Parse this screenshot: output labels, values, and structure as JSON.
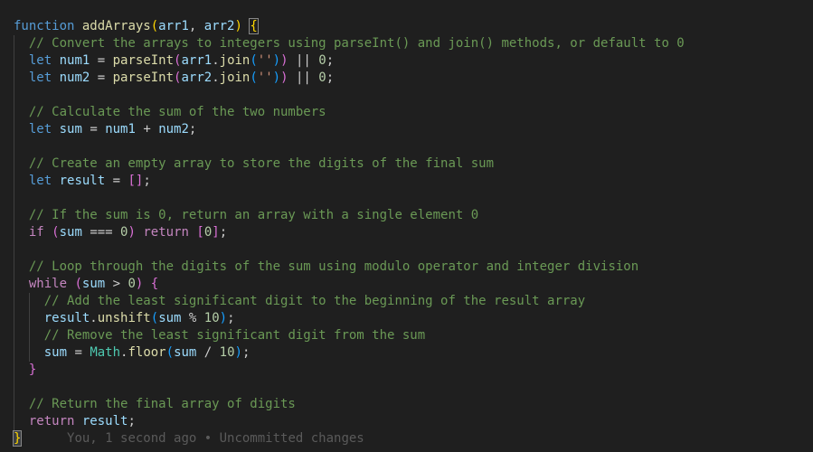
{
  "editor": {
    "lines": [
      {
        "id": "l1",
        "indent": "",
        "tokens": [
          [
            "kw",
            "function"
          ],
          [
            "pn",
            " "
          ],
          [
            "fn",
            "addArrays"
          ],
          [
            "br1",
            "("
          ],
          [
            "var",
            "arr1"
          ],
          [
            "pn",
            ", "
          ],
          [
            "var",
            "arr2"
          ],
          [
            "br1",
            ")"
          ],
          [
            "pn",
            " "
          ],
          [
            "br1",
            "{"
          ]
        ]
      },
      {
        "id": "l2",
        "indent": "  ",
        "tokens": [
          [
            "cm",
            "// Convert the arrays to integers using parseInt() and join() methods, or default to 0"
          ]
        ]
      },
      {
        "id": "l3",
        "indent": "  ",
        "tokens": [
          [
            "kw",
            "let"
          ],
          [
            "pn",
            " "
          ],
          [
            "var",
            "num1"
          ],
          [
            "pn",
            " = "
          ],
          [
            "fn",
            "parseInt"
          ],
          [
            "br2",
            "("
          ],
          [
            "var",
            "arr1"
          ],
          [
            "pn",
            "."
          ],
          [
            "fn",
            "join"
          ],
          [
            "br3",
            "("
          ],
          [
            "str",
            "''"
          ],
          [
            "br3",
            ")"
          ],
          [
            "br2",
            ")"
          ],
          [
            "pn",
            " || "
          ],
          [
            "num",
            "0"
          ],
          [
            "pn",
            ";"
          ]
        ]
      },
      {
        "id": "l4",
        "indent": "  ",
        "tokens": [
          [
            "kw",
            "let"
          ],
          [
            "pn",
            " "
          ],
          [
            "var",
            "num2"
          ],
          [
            "pn",
            " = "
          ],
          [
            "fn",
            "parseInt"
          ],
          [
            "br2",
            "("
          ],
          [
            "var",
            "arr2"
          ],
          [
            "pn",
            "."
          ],
          [
            "fn",
            "join"
          ],
          [
            "br3",
            "("
          ],
          [
            "str",
            "''"
          ],
          [
            "br3",
            ")"
          ],
          [
            "br2",
            ")"
          ],
          [
            "pn",
            " || "
          ],
          [
            "num",
            "0"
          ],
          [
            "pn",
            ";"
          ]
        ]
      },
      {
        "id": "l5",
        "indent": "",
        "tokens": []
      },
      {
        "id": "l6",
        "indent": "  ",
        "tokens": [
          [
            "cm",
            "// Calculate the sum of the two numbers"
          ]
        ]
      },
      {
        "id": "l7",
        "indent": "  ",
        "tokens": [
          [
            "kw",
            "let"
          ],
          [
            "pn",
            " "
          ],
          [
            "var",
            "sum"
          ],
          [
            "pn",
            " = "
          ],
          [
            "var",
            "num1"
          ],
          [
            "pn",
            " + "
          ],
          [
            "var",
            "num2"
          ],
          [
            "pn",
            ";"
          ]
        ]
      },
      {
        "id": "l8",
        "indent": "",
        "tokens": []
      },
      {
        "id": "l9",
        "indent": "  ",
        "tokens": [
          [
            "cm",
            "// Create an empty array to store the digits of the final sum"
          ]
        ]
      },
      {
        "id": "l10",
        "indent": "  ",
        "tokens": [
          [
            "kw",
            "let"
          ],
          [
            "pn",
            " "
          ],
          [
            "var",
            "result"
          ],
          [
            "pn",
            " = "
          ],
          [
            "br2",
            "[]"
          ],
          [
            "pn",
            ";"
          ]
        ]
      },
      {
        "id": "l11",
        "indent": "",
        "tokens": []
      },
      {
        "id": "l12",
        "indent": "  ",
        "tokens": [
          [
            "cm",
            "// If the sum is 0, return an array with a single element 0"
          ]
        ]
      },
      {
        "id": "l13",
        "indent": "  ",
        "tokens": [
          [
            "kw2",
            "if"
          ],
          [
            "pn",
            " "
          ],
          [
            "br2",
            "("
          ],
          [
            "var",
            "sum"
          ],
          [
            "pn",
            " === "
          ],
          [
            "num",
            "0"
          ],
          [
            "br2",
            ")"
          ],
          [
            "pn",
            " "
          ],
          [
            "kw2",
            "return"
          ],
          [
            "pn",
            " "
          ],
          [
            "br2",
            "["
          ],
          [
            "num",
            "0"
          ],
          [
            "br2",
            "]"
          ],
          [
            "pn",
            ";"
          ]
        ]
      },
      {
        "id": "l14",
        "indent": "",
        "tokens": []
      },
      {
        "id": "l15",
        "indent": "  ",
        "tokens": [
          [
            "cm",
            "// Loop through the digits of the sum using modulo operator and integer division"
          ]
        ]
      },
      {
        "id": "l16",
        "indent": "  ",
        "tokens": [
          [
            "kw2",
            "while"
          ],
          [
            "pn",
            " "
          ],
          [
            "br2",
            "("
          ],
          [
            "var",
            "sum"
          ],
          [
            "pn",
            " > "
          ],
          [
            "num",
            "0"
          ],
          [
            "br2",
            ")"
          ],
          [
            "pn",
            " "
          ],
          [
            "br2",
            "{"
          ]
        ]
      },
      {
        "id": "l17",
        "indent": "    ",
        "tokens": [
          [
            "cm",
            "// Add the least significant digit to the beginning of the result array"
          ]
        ]
      },
      {
        "id": "l18",
        "indent": "    ",
        "tokens": [
          [
            "var",
            "result"
          ],
          [
            "pn",
            "."
          ],
          [
            "fn",
            "unshift"
          ],
          [
            "br3",
            "("
          ],
          [
            "var",
            "sum"
          ],
          [
            "pn",
            " % "
          ],
          [
            "num",
            "10"
          ],
          [
            "br3",
            ")"
          ],
          [
            "pn",
            ";"
          ]
        ]
      },
      {
        "id": "l19",
        "indent": "    ",
        "tokens": [
          [
            "cm",
            "// Remove the least significant digit from the sum"
          ]
        ]
      },
      {
        "id": "l20",
        "indent": "    ",
        "tokens": [
          [
            "var",
            "sum"
          ],
          [
            "pn",
            " = "
          ],
          [
            "obj",
            "Math"
          ],
          [
            "pn",
            "."
          ],
          [
            "fn",
            "floor"
          ],
          [
            "br3",
            "("
          ],
          [
            "var",
            "sum"
          ],
          [
            "pn",
            " / "
          ],
          [
            "num",
            "10"
          ],
          [
            "br3",
            ")"
          ],
          [
            "pn",
            ";"
          ]
        ]
      },
      {
        "id": "l21",
        "indent": "  ",
        "tokens": [
          [
            "br2",
            "}"
          ]
        ]
      },
      {
        "id": "l22",
        "indent": "",
        "tokens": []
      },
      {
        "id": "l23",
        "indent": "  ",
        "tokens": [
          [
            "cm",
            "// Return the final array of digits"
          ]
        ]
      },
      {
        "id": "l24",
        "indent": "  ",
        "tokens": [
          [
            "kw2",
            "return"
          ],
          [
            "pn",
            " "
          ],
          [
            "var",
            "result"
          ],
          [
            "pn",
            ";"
          ]
        ]
      },
      {
        "id": "l25",
        "indent": "",
        "tokens": [
          [
            "br1",
            "}"
          ]
        ],
        "blame": "You, 1 second ago • Uncommitted changes"
      }
    ]
  }
}
